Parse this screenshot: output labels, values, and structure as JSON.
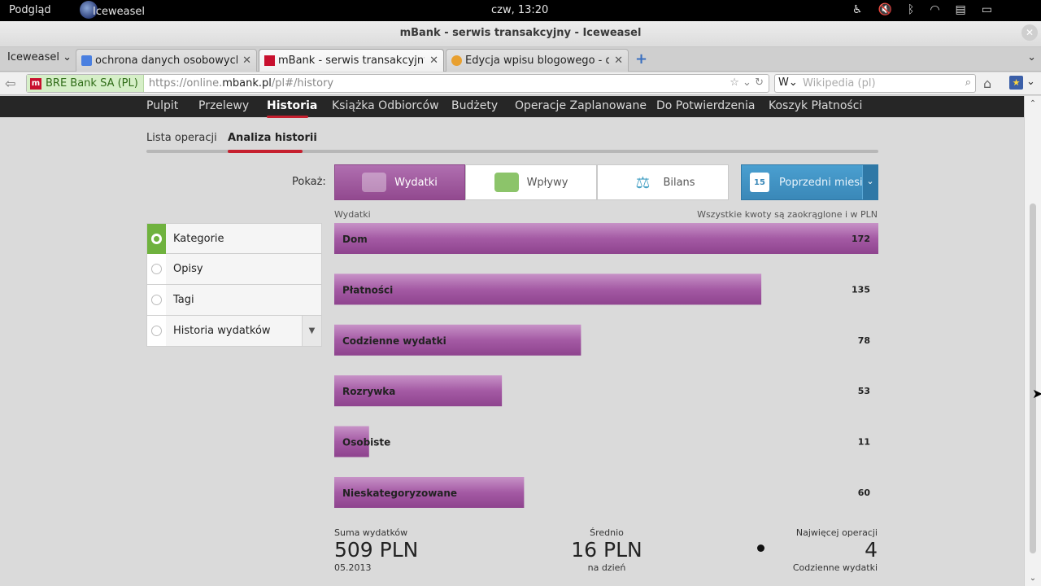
{
  "panel": {
    "activities": "Podgląd",
    "app": "Iceweasel",
    "clock": "czw, 13:20",
    "tray_icons": [
      "accessibility-icon",
      "volume-muted-icon",
      "bluetooth-icon",
      "wifi-icon",
      "clipboard-icon",
      "battery-icon"
    ]
  },
  "window": {
    "title": "mBank - serwis transakcyjny - Iceweasel"
  },
  "browser": {
    "menu_label": "Iceweasel",
    "tabs": [
      {
        "label": "ochrona danych osobowych ...",
        "active": false
      },
      {
        "label": "mBank - serwis transakcyjny",
        "active": true
      },
      {
        "label": "Edycja wpisu blogowego - d...",
        "active": false
      }
    ],
    "identity": "BRE Bank SA (PL)",
    "url_prefix": "https://online.",
    "url_domain": "mbank.pl",
    "url_path": "/pl#/history",
    "search_engine": "W",
    "search_placeholder": "Wikipedia (pl)"
  },
  "nav": {
    "items": [
      "Pulpit",
      "Przelewy",
      "Historia",
      "Książka Odbiorców",
      "Budżety",
      "Operacje Zaplanowane",
      "Do Potwierdzenia",
      "Koszyk Płatności"
    ],
    "active": "Historia"
  },
  "subtabs": [
    "Lista operacji",
    "Analiza historii"
  ],
  "show_label": "Pokaż:",
  "segments": [
    {
      "label": "Wydatki",
      "active": true
    },
    {
      "label": "Wpływy",
      "active": false
    },
    {
      "label": "Bilans",
      "active": false
    }
  ],
  "period": {
    "label": "Poprzedni miesiąc",
    "day": "15"
  },
  "radios": [
    {
      "label": "Kategorie",
      "selected": true
    },
    {
      "label": "Opisy",
      "selected": false
    },
    {
      "label": "Tagi",
      "selected": false
    },
    {
      "label": "Historia wydatków",
      "selected": false
    }
  ],
  "chart_header": {
    "left": "Wydatki",
    "right": "Wszystkie kwoty są zaokrąglone i w PLN"
  },
  "chart_data": {
    "type": "bar",
    "orientation": "horizontal",
    "categories": [
      "Dom",
      "Płatności",
      "Codzienne wydatki",
      "Rozrywka",
      "Osobiste",
      "Nieskategoryzowane"
    ],
    "values": [
      172,
      135,
      78,
      53,
      11,
      60
    ],
    "color": "#a45aa4",
    "xlim": [
      0,
      172
    ]
  },
  "summary": {
    "total_label": "Suma wydatków",
    "total_value": "509 PLN",
    "total_sub": "05.2013",
    "avg_label": "Średnio",
    "avg_value": "16 PLN",
    "avg_sub": "na dzień",
    "most_label": "Najwięcej operacji",
    "most_value": "4",
    "most_sub": "Codzienne wydatki"
  }
}
